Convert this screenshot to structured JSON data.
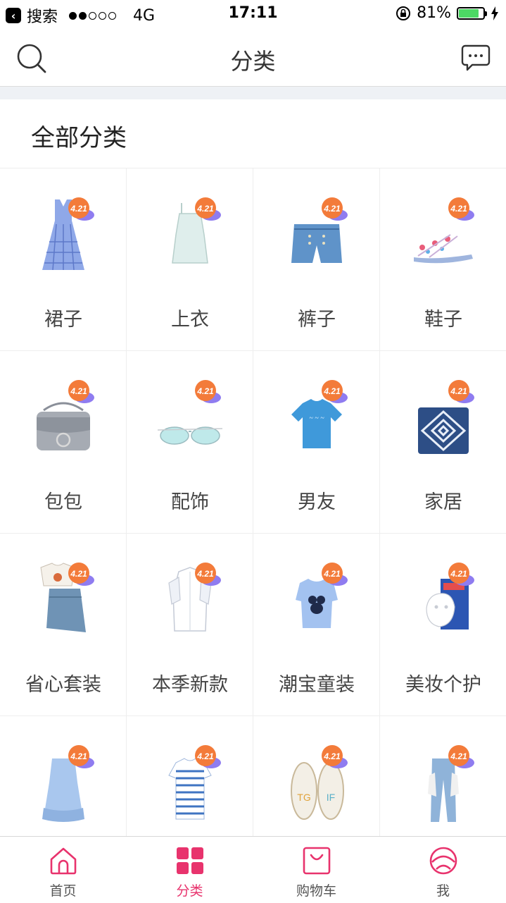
{
  "status_bar": {
    "back_app": "搜索",
    "network": "4G",
    "time": "17:11",
    "battery": "81%",
    "battery_level": 0.81,
    "signal_filled": 2,
    "signal_total": 5
  },
  "nav": {
    "title": "分类",
    "left_icon": "search-icon",
    "right_icon": "message-icon"
  },
  "section": {
    "title": "全部分类"
  },
  "promo_badge": "4.21",
  "categories": [
    {
      "label": "裙子",
      "icon": "dress-icon"
    },
    {
      "label": "上衣",
      "icon": "top-icon"
    },
    {
      "label": "裤子",
      "icon": "shorts-icon"
    },
    {
      "label": "鞋子",
      "icon": "sandal-icon"
    },
    {
      "label": "包包",
      "icon": "bag-icon"
    },
    {
      "label": "配饰",
      "icon": "sunglasses-icon"
    },
    {
      "label": "男友",
      "icon": "tshirt-icon"
    },
    {
      "label": "家居",
      "icon": "pillow-icon"
    },
    {
      "label": "省心套装",
      "icon": "outfit-set-icon"
    },
    {
      "label": "本季新款",
      "icon": "shirt-icon"
    },
    {
      "label": "潮宝童装",
      "icon": "kids-top-icon"
    },
    {
      "label": "美妆个护",
      "icon": "mask-icon"
    },
    {
      "label": "",
      "icon": "blue-dress-icon"
    },
    {
      "label": "",
      "icon": "striped-tee-icon"
    },
    {
      "label": "",
      "icon": "espadrilles-icon"
    },
    {
      "label": "",
      "icon": "jeans-icon"
    }
  ],
  "tabs": [
    {
      "label": "首页",
      "icon": "home-icon",
      "active": false
    },
    {
      "label": "分类",
      "icon": "category-icon",
      "active": true
    },
    {
      "label": "购物车",
      "icon": "cart-icon",
      "active": false
    },
    {
      "label": "我",
      "icon": "profile-icon",
      "active": false
    }
  ],
  "colors": {
    "accent": "#e8336d",
    "battery": "#4cd964",
    "band": "#eef1f5"
  }
}
